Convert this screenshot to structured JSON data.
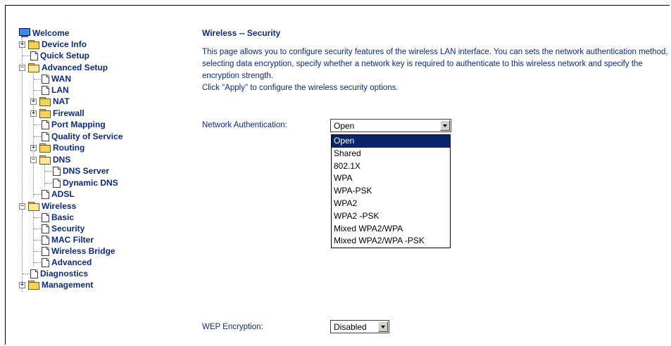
{
  "tree": {
    "welcome": "Welcome",
    "device_info": "Device Info",
    "quick_setup": "Quick Setup",
    "advanced_setup": "Advanced Setup",
    "wan": "WAN",
    "lan": "LAN",
    "nat": "NAT",
    "firewall": "Firewall",
    "port_mapping": "Port Mapping",
    "qos": "Quality of Service",
    "routing": "Routing",
    "dns": "DNS",
    "dns_server": "DNS Server",
    "dynamic_dns": "Dynamic DNS",
    "adsl": "ADSL",
    "wireless": "Wireless",
    "basic": "Basic",
    "security": "Security",
    "mac_filter": "MAC Filter",
    "wireless_bridge": "Wireless Bridge",
    "advanced": "Advanced",
    "diagnostics": "Diagnostics",
    "management": "Management",
    "expand_symbol": "+",
    "collapse_symbol": "−"
  },
  "page": {
    "title": "Wireless -- Security",
    "description": "This page allows you to configure security features of the wireless LAN interface. You can sets the network authentication method, selecting data encryption, specify whether a network key is required to authenticate to this wireless network and specify the encryption strength.",
    "apply_hint": "Click \"Apply\" to configure the wireless security options."
  },
  "form": {
    "network_auth_label": "Network Authentication:",
    "network_auth_value": "Open",
    "network_auth_options": [
      "Open",
      "Shared",
      "802.1X",
      "WPA",
      "WPA-PSK",
      "WPA2",
      "WPA2 -PSK",
      "Mixed WPA2/WPA",
      "Mixed WPA2/WPA -PSK"
    ],
    "wep_label": "WEP Encryption:",
    "wep_value": "Disabled"
  },
  "colors": {
    "link_blue": "#0a2a8c",
    "selection": "#0a246a",
    "folder_yellow": "#f5d25a"
  }
}
